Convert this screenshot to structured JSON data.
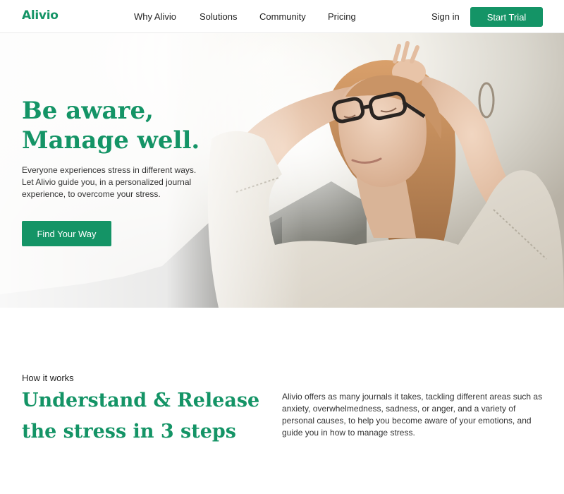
{
  "nav": {
    "logo": "Alivio",
    "links": [
      "Why Alivio",
      "Solutions",
      "Community",
      "Pricing"
    ],
    "sign_in": "Sign in",
    "cta": "Start Trial"
  },
  "hero": {
    "title_line1": "Be aware,",
    "title_line2": "Manage well.",
    "subtitle": "Everyone experiences stress in different ways. Let Alivio guide you, in a personalized journal experience, to overcome your stress.",
    "cta": "Find Your Way",
    "image": "woman-relaxing-photo"
  },
  "how": {
    "kicker": "How it works",
    "title_line1": "Understand & Release",
    "title_line2": "the stress in 3 steps",
    "description": "Alivio offers as many journals it takes, tackling different areas such as anxiety, overwhelmedness, sadness, or anger, and a variety of personal causes, to help you become aware of your emotions, and guide you in how to manage stress."
  },
  "colors": {
    "brand": "#149466",
    "text": "#222222"
  }
}
